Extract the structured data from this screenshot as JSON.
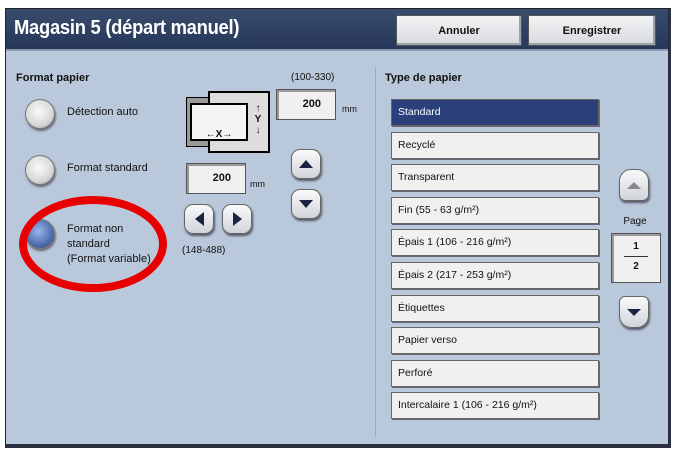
{
  "header": {
    "title": "Magasin 5 (départ manuel)",
    "cancel_label": "Annuler",
    "save_label": "Enregistrer"
  },
  "paper_format": {
    "heading": "Format papier",
    "options": [
      {
        "label": "Détection auto",
        "selected": false
      },
      {
        "label": "Format standard",
        "selected": false
      },
      {
        "label": "Format non standard (Format variable)",
        "lines": [
          "Format non",
          "standard",
          "(Format variable)"
        ],
        "selected": true
      }
    ],
    "y_range": "(100-330)",
    "y_value": "200",
    "y_unit": "mm",
    "x_range": "(148-488)",
    "x_value": "200",
    "x_unit": "mm",
    "diagram": {
      "x_label": "X",
      "y_label": "Y"
    }
  },
  "paper_type": {
    "heading": "Type de papier",
    "items": [
      "Standard",
      "Recyclé",
      "Transparent",
      "Fin (55 - 63 g/m²)",
      "Épais 1 (106 - 216 g/m²)",
      "Épais 2 (217 - 253 g/m²)",
      "Étiquettes",
      "Papier verso",
      "Perforé",
      "Intercalaire 1 (106 - 216 g/m²)"
    ],
    "selected_index": 0,
    "page_label": "Page",
    "current_page": "1",
    "total_pages": "2"
  },
  "colors": {
    "highlight": "#e00000",
    "selected": "#2b3f7a",
    "title_bar": "#2d3f60"
  }
}
